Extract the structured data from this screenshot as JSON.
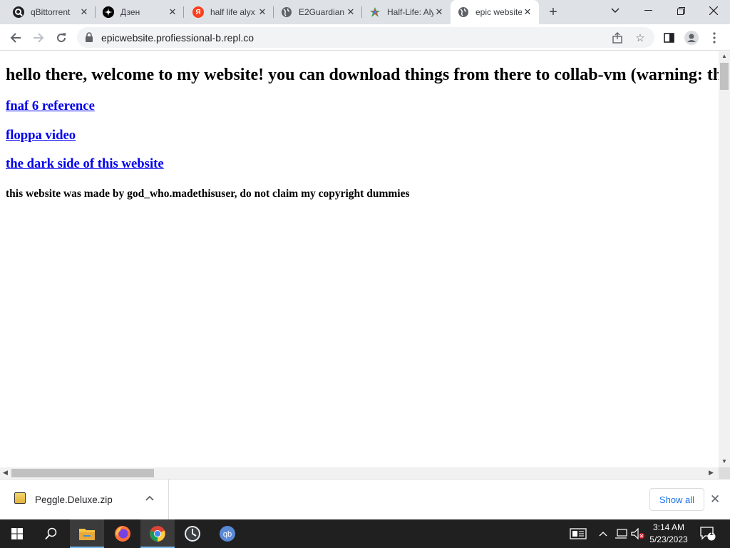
{
  "tabs": [
    {
      "title": "qBittorrent",
      "favicon": "qbittorrent-favicon",
      "color": "#202124"
    },
    {
      "title": "Дзен",
      "favicon": "dzen-favicon",
      "color": "#000000"
    },
    {
      "title": "half life alyx",
      "favicon": "yandex-favicon",
      "color": "#fc3f1d"
    },
    {
      "title": "E2Guardian",
      "favicon": "globe-favicon",
      "color": "#5f6368"
    },
    {
      "title": "Half-Life: Alyx",
      "favicon": "half-life-favicon",
      "color": "#ea4335"
    },
    {
      "title": "epic website",
      "favicon": "globe-favicon",
      "color": "#5f6368"
    }
  ],
  "address_bar": {
    "url": "epicwebsite.profiessional-b.repl.co"
  },
  "page": {
    "heading": "hello there, welcome to my website! you can download things from there to collab-vm (warning: th",
    "links": [
      "fnaf 6 reference",
      "floppa video",
      "the dark side of this website"
    ],
    "credit": "this website was made by god_who.madethisuser, do not claim my copyright dummies"
  },
  "download_shelf": {
    "filename": "Peggle.Deluxe.zip",
    "show_all_label": "Show all"
  },
  "taskbar": {
    "time": "3:14 AM",
    "date": "5/23/2023",
    "notification_count": "1"
  },
  "colors": {
    "link": "#0000ee",
    "accent": "#1a73e8",
    "tabstrip": "#dee1e6",
    "taskbar": "#202020"
  }
}
